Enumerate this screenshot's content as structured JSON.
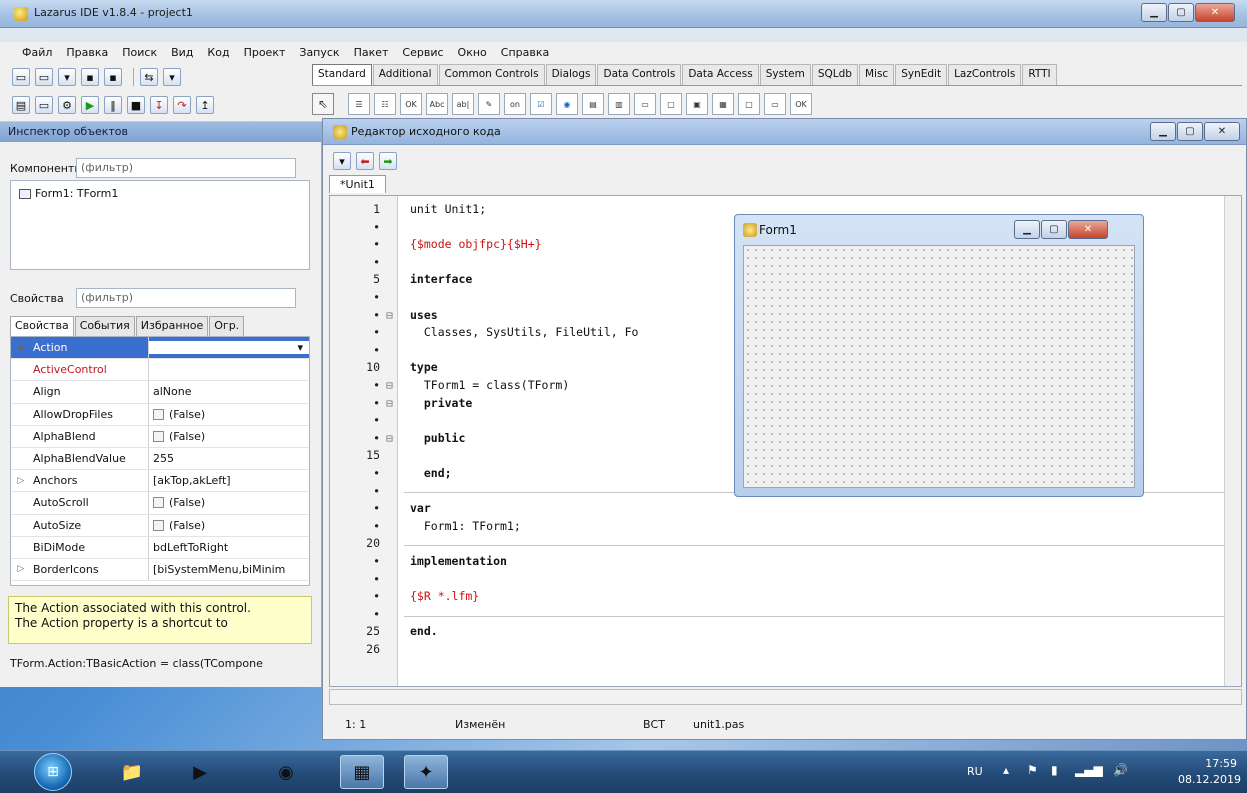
{
  "ide": {
    "title": "Lazarus IDE v1.8.4 - project1",
    "menu": [
      "Файл",
      "Правка",
      "Поиск",
      "Вид",
      "Код",
      "Проект",
      "Запуск",
      "Пакет",
      "Сервис",
      "Окно",
      "Справка"
    ],
    "palette_tabs": [
      "Standard",
      "Additional",
      "Common Controls",
      "Dialogs",
      "Data Controls",
      "Data Access",
      "System",
      "SQLdb",
      "Misc",
      "SynEdit",
      "LazControls",
      "RTTI"
    ],
    "palette_active": "Standard",
    "palette_icon_labels": [
      "OK",
      "Abc",
      "ab|",
      "on",
      "OK"
    ]
  },
  "inspector": {
    "title": "Инспектор объектов",
    "components_label": "Компоненты",
    "components_filter_placeholder": "(фильтр)",
    "tree_item": "Form1: TForm1",
    "properties_label": "Свойства",
    "properties_filter_placeholder": "(фильтр)",
    "tabs": [
      "Свойства",
      "События",
      "Избранное",
      "Огр."
    ],
    "properties": [
      {
        "name": "Action",
        "value": "",
        "expand": "◆",
        "selected": true
      },
      {
        "name": "ActiveControl",
        "value": "",
        "red": true
      },
      {
        "name": "Align",
        "value": "alNone"
      },
      {
        "name": "AllowDropFiles",
        "value": "(False)",
        "checkbox": true
      },
      {
        "name": "AlphaBlend",
        "value": "(False)",
        "checkbox": true
      },
      {
        "name": "AlphaBlendValue",
        "value": "255"
      },
      {
        "name": "Anchors",
        "value": "[akTop,akLeft]",
        "expand": "▷"
      },
      {
        "name": "AutoScroll",
        "value": "(False)",
        "checkbox": true
      },
      {
        "name": "AutoSize",
        "value": "(False)",
        "checkbox": true
      },
      {
        "name": "BiDiMode",
        "value": "bdLeftToRight"
      },
      {
        "name": "BorderIcons",
        "value": "[biSystemMenu,biMinim",
        "expand": "▷"
      }
    ],
    "hint_line1": "The Action associated with this control.",
    "hint_line2": "The Action property is a shortcut to",
    "declaration": "TForm.Action:TBasicAction = class(TCompone"
  },
  "editor": {
    "title": "Редактор исходного кода",
    "tab": "*Unit1",
    "lines": [
      {
        "n": "1",
        "text": "unit Unit1;",
        "kind": "kw-first"
      },
      {
        "n": "•",
        "text": ""
      },
      {
        "n": "•",
        "text": "{$mode objfpc}{$H+}",
        "kind": "dir"
      },
      {
        "n": "•",
        "text": ""
      },
      {
        "n": "5",
        "text": "interface",
        "kind": "kw"
      },
      {
        "n": "•",
        "text": ""
      },
      {
        "n": "•",
        "text": "uses",
        "kind": "kw",
        "fold": "⊟"
      },
      {
        "n": "•",
        "text": "  Classes, SysUtils, FileUtil, Fo"
      },
      {
        "n": "•",
        "text": ""
      },
      {
        "n": "10",
        "text": "type",
        "kind": "kw"
      },
      {
        "n": "•",
        "text": "  TForm1 = class(TForm)",
        "fold": "⊟"
      },
      {
        "n": "•",
        "text": "  private",
        "kind": "kw",
        "fold": "⊟"
      },
      {
        "n": "•",
        "text": ""
      },
      {
        "n": "•",
        "text": "  public",
        "kind": "kw",
        "fold": "⊟"
      },
      {
        "n": "15",
        "text": ""
      },
      {
        "n": "•",
        "text": "  end;",
        "kind": "kw"
      },
      {
        "n": "•",
        "text": ""
      },
      {
        "n": "•",
        "text": "var",
        "kind": "kw"
      },
      {
        "n": "•",
        "text": "  Form1: TForm1;"
      },
      {
        "n": "20",
        "text": ""
      },
      {
        "n": "•",
        "text": "implementation",
        "kind": "kw"
      },
      {
        "n": "•",
        "text": ""
      },
      {
        "n": "•",
        "text": "{$R *.lfm}",
        "kind": "dir"
      },
      {
        "n": "•",
        "text": ""
      },
      {
        "n": "25",
        "text": "end.",
        "kind": "kw"
      },
      {
        "n": "26",
        "text": ""
      }
    ],
    "status": {
      "position": "1: 1",
      "modified": "Изменён",
      "mode": "ВСТ",
      "file": "unit1.pas"
    }
  },
  "form1": {
    "title": "Form1"
  },
  "taskbar": {
    "lang": "RU",
    "time": "17:59",
    "date": "08.12.2019"
  }
}
